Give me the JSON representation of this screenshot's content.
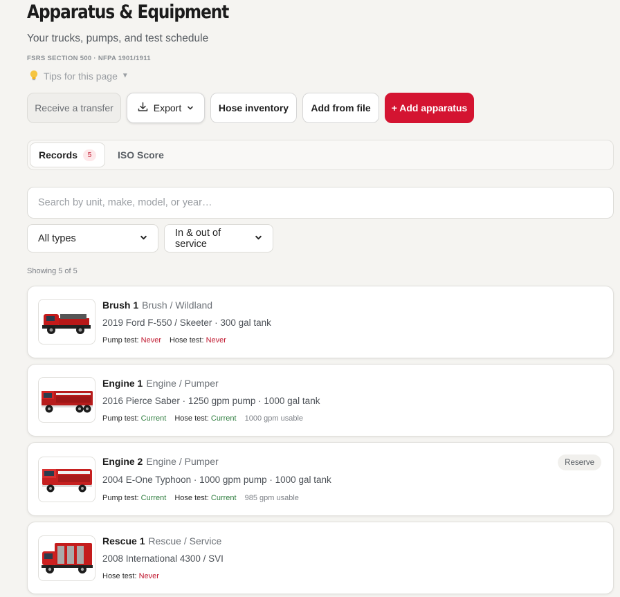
{
  "header": {
    "title": "Apparatus & Equipment",
    "subtitle": "Your trucks, pumps, and test schedule",
    "section": "FSRS SECTION 500 · NFPA 1901/1911",
    "tips_label": "Tips for this page"
  },
  "toolbar": {
    "receive": "Receive a transfer",
    "export": "Export",
    "hose_inventory": "Hose inventory",
    "add_from_file": "Add from file",
    "add_apparatus": "+ Add apparatus"
  },
  "tabs": {
    "records_label": "Records",
    "records_count": "5",
    "iso_label": "ISO Score"
  },
  "search": {
    "placeholder": "Search by unit, make, model, or year…"
  },
  "filters": {
    "type_value": "All types",
    "service_value": "In & out of service"
  },
  "showing": "Showing 5 of 5",
  "apparatus": [
    {
      "name": "Brush 1",
      "type": "Brush / Wildland",
      "spec": "2019 Ford F-550 / Skeeter · 300 gal tank",
      "pump_label": "Pump test:",
      "pump_status": "Never",
      "hose_label": "Hose test:",
      "hose_status": "Never"
    },
    {
      "name": "Engine 1",
      "type": "Engine / Pumper",
      "spec": "2016 Pierce Saber · 1250 gpm pump · 1000 gal tank",
      "pump_label": "Pump test:",
      "pump_status": "Current",
      "hose_label": "Hose test:",
      "hose_status": "Current",
      "usable": "1000 gpm usable"
    },
    {
      "name": "Engine 2",
      "type": "Engine / Pumper",
      "spec": "2004 E-One Typhoon · 1000 gpm pump · 1000 gal tank",
      "pump_label": "Pump test:",
      "pump_status": "Current",
      "hose_label": "Hose test:",
      "hose_status": "Current",
      "usable": "985 gpm usable",
      "badge": "Reserve"
    },
    {
      "name": "Rescue 1",
      "type": "Rescue / Service",
      "spec": "2008 International 4300 / SVI",
      "hose_label": "Hose test:",
      "hose_status": "Never"
    }
  ],
  "colors": {
    "accent": "#d41431",
    "never": "#c0182f",
    "current": "#2e7d3e"
  }
}
